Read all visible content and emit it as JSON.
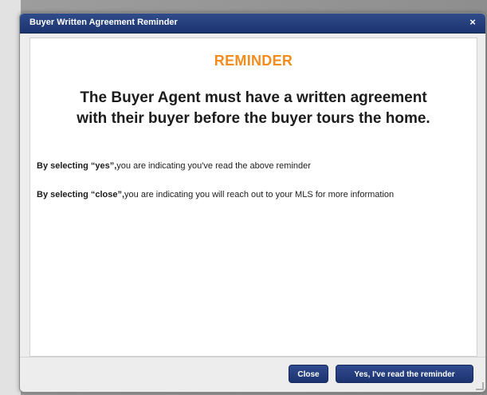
{
  "dialog": {
    "title": "Buyer Written Agreement Reminder",
    "close_glyph": "×"
  },
  "content": {
    "heading": "REMINDER",
    "statement_line1": "The Buyer Agent must have a written agreement",
    "statement_line2": "with their buyer before the buyer tours the home.",
    "yes_prefix": "By selecting “yes”,",
    "yes_text": "you are indicating you've read the above reminder",
    "close_prefix": "By selecting “close”,",
    "close_text": "you are indicating you will reach out to your MLS for more information"
  },
  "buttons": {
    "close_label": "Close",
    "confirm_label": "Yes, I've read the reminder"
  },
  "colors": {
    "title_bar": "#1c3470",
    "heading": "#f28c1c",
    "button": "#1d336f"
  }
}
